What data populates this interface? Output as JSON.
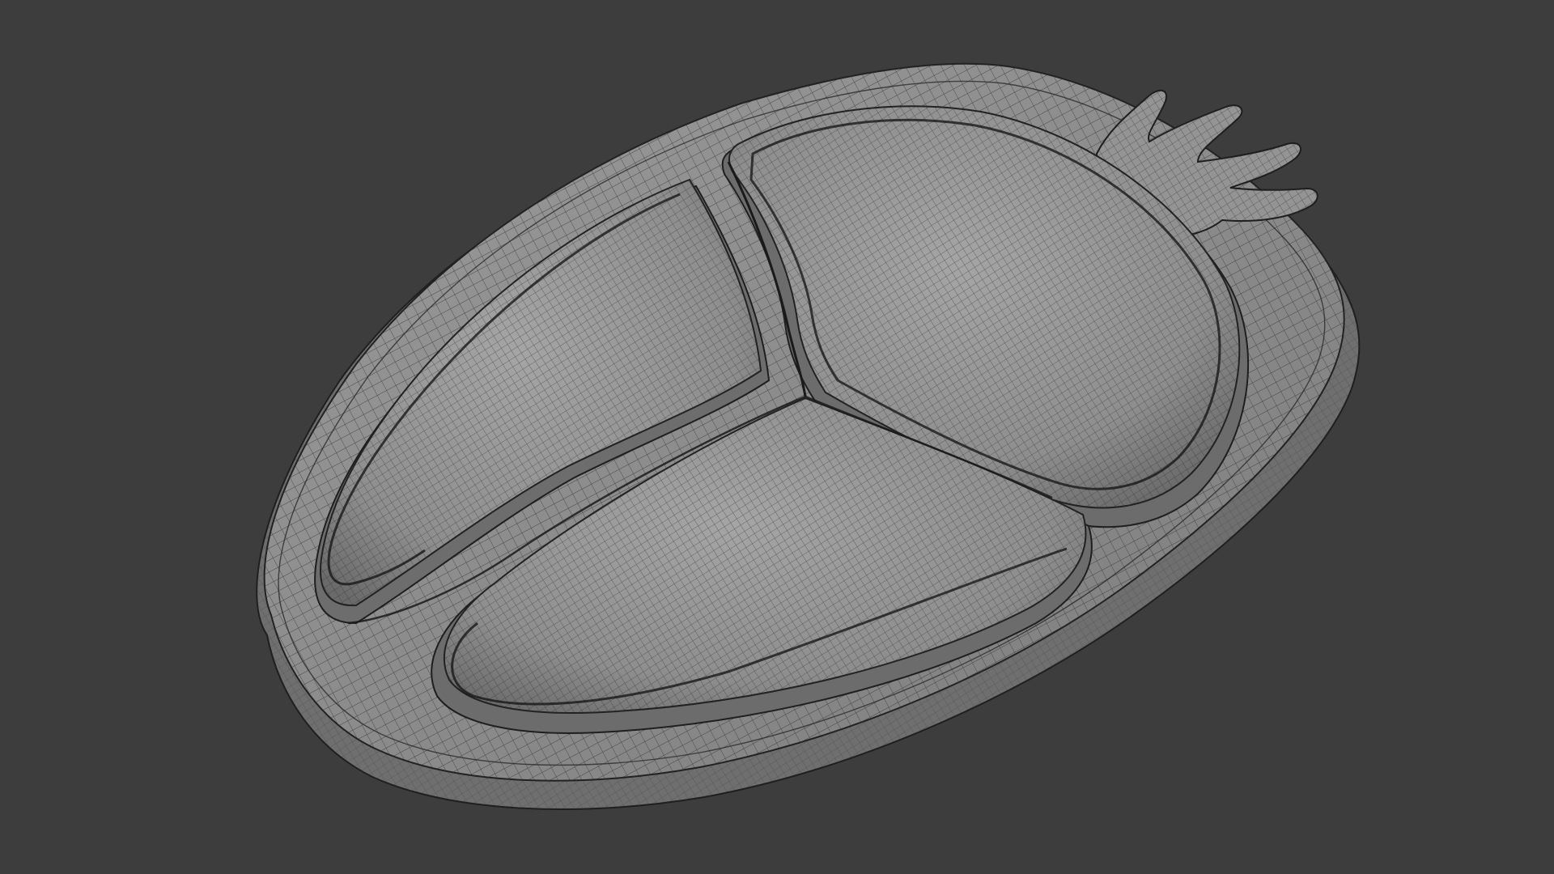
{
  "viewport": {
    "background_color": "#3d3d3d",
    "shading_mode": "solid-wireframe",
    "object_icon": "scarab-mesh-icon"
  },
  "mesh": {
    "name": "",
    "surface_color": "#8f8f8f",
    "wire_color": "#2e2e2e",
    "parts": [
      {
        "id": "base-plate",
        "icon": "base-plate-icon"
      },
      {
        "id": "head-crest",
        "icon": "crest-icon"
      },
      {
        "id": "pronotum-pad",
        "icon": "pad-icon"
      },
      {
        "id": "left-elytron-pad",
        "icon": "pad-icon"
      },
      {
        "id": "right-elytron-pad",
        "icon": "pad-icon"
      }
    ]
  }
}
